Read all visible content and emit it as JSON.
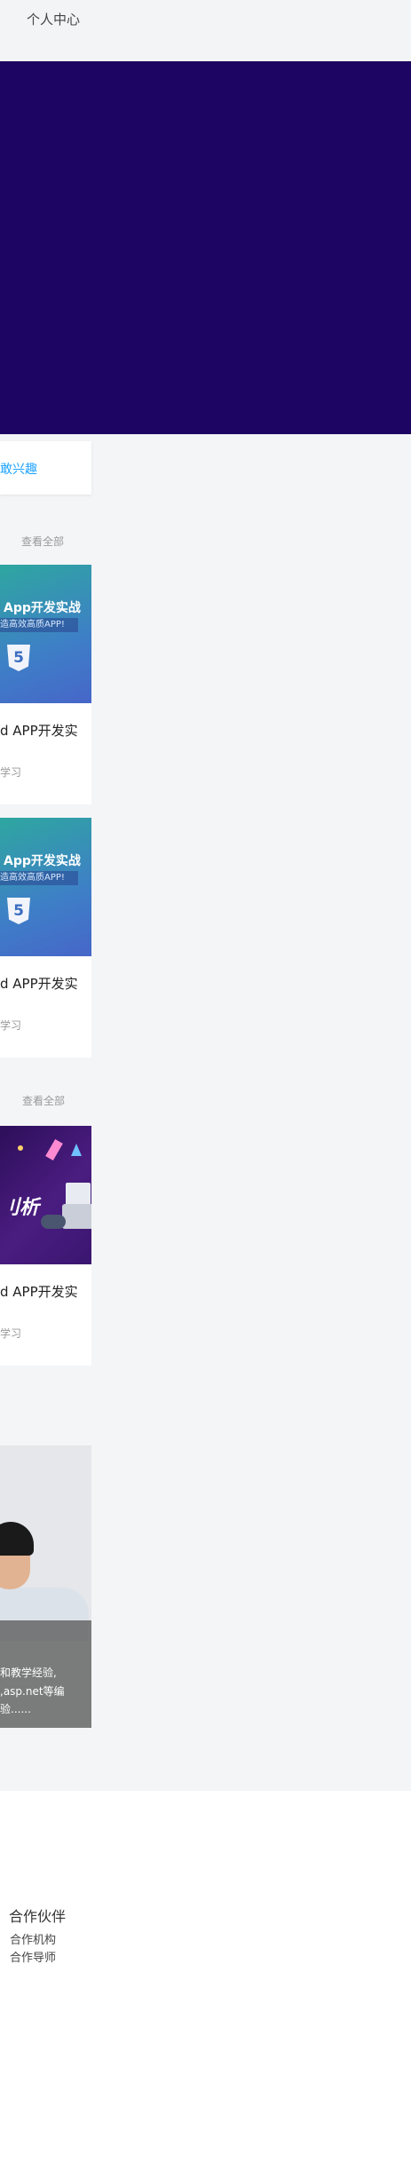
{
  "header": {
    "user_center": "个人中心"
  },
  "interest": {
    "label": "敢兴趣"
  },
  "section_hot": {
    "see_all": "查看全部"
  },
  "section_new": {
    "see_all": "查看全部"
  },
  "courses": [
    {
      "thumb_title": "App开发实战",
      "thumb_sub": "造高效高质APP!",
      "thumb_badge": "5",
      "title": "d  APP开发实",
      "sub": "学习"
    },
    {
      "thumb_title": "App开发实战",
      "thumb_sub": "造高效高质APP!",
      "thumb_badge": "5",
      "title": "d  APP开发实",
      "sub": "学习"
    },
    {
      "thumb_text": "刂析",
      "title": "d  APP开发实",
      "sub": "学习"
    }
  ],
  "teacher": {
    "lines": [
      "和教学经验,",
      ",asp.net等编",
      "验......"
    ]
  },
  "footer": {
    "title": "合作伙伴",
    "links": [
      "合作机构",
      "合作导师"
    ]
  },
  "colors": {
    "banner": "#1c0563",
    "accent": "#1ea3ff"
  }
}
